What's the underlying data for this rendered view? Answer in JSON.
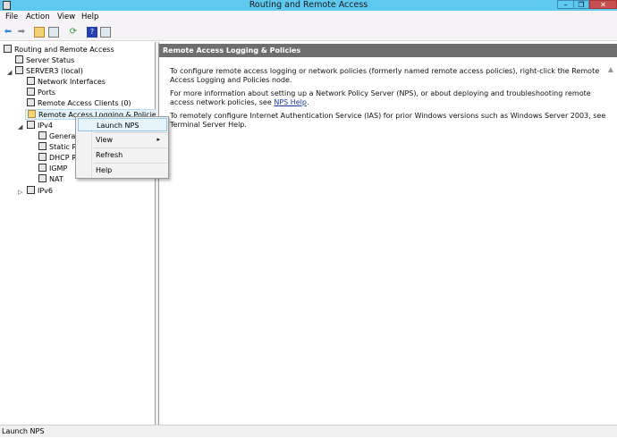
{
  "window": {
    "title": "Routing and Remote Access",
    "minimize": "–",
    "restore": "❐",
    "close": "✕"
  },
  "menu": [
    "File",
    "Action",
    "View",
    "Help"
  ],
  "toolbar": [
    "back",
    "forward",
    "up-folder",
    "show-hide-tree",
    "refresh",
    "help",
    "properties"
  ],
  "tree": [
    {
      "label": "Routing and Remote Access",
      "level": 0
    },
    {
      "label": "Server Status",
      "level": 1
    },
    {
      "label": "SERVER3 (local)",
      "level": 1,
      "expanded": true
    },
    {
      "label": "Network Interfaces",
      "level": 2
    },
    {
      "label": "Ports",
      "level": 2
    },
    {
      "label": "Remote Access Clients (0)",
      "level": 2
    },
    {
      "label": "Remote Access Logging & Policies",
      "level": 2,
      "selected": true
    },
    {
      "label": "IPv4",
      "level": 2,
      "expanded": true
    },
    {
      "label": "General",
      "level": 3
    },
    {
      "label": "Static Ro",
      "level": 3
    },
    {
      "label": "DHCP R",
      "level": 3
    },
    {
      "label": "IGMP",
      "level": 3
    },
    {
      "label": "NAT",
      "level": 3
    },
    {
      "label": "IPv6",
      "level": 2,
      "expanded": false
    }
  ],
  "right": {
    "header": "Remote Access Logging & Policies",
    "p1": "To configure remote access logging or network policies (formerly named remote access policies), right-click the Remote Access Logging and Policies node.",
    "p2_pre": "For more information about setting up a Network Policy Server (NPS), or about deploying and troubleshooting remote access network policies, see ",
    "p2_link": "NPS Help",
    "p2_post": ".",
    "p3": "To remotely configure Internet Authentication Service (IAS) for prior Windows versions such as Windows Server 2003, see Terminal Server Help."
  },
  "context_menu": {
    "items": [
      "Launch NPS",
      "View",
      "Refresh",
      "Help"
    ],
    "submenu_arrow": "▸"
  },
  "status": "Launch NPS"
}
